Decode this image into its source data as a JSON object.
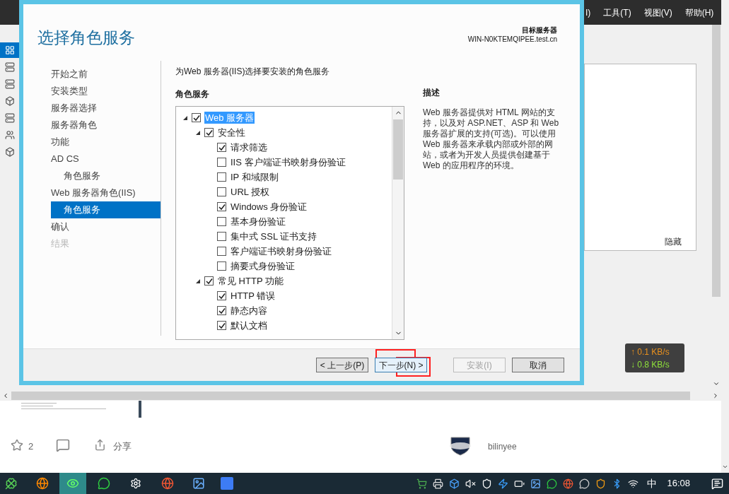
{
  "background_app": {
    "menu": [
      "I)",
      "工具(T)",
      "视图(V)",
      "帮助(H)"
    ],
    "hide_link": "隐藏"
  },
  "dialog": {
    "title": "选择角色服务",
    "target_label": "目标服务器",
    "target_server": "WIN-N0KTEMQIPEE.test.cn",
    "steps": [
      {
        "label": "开始之前",
        "selected": false,
        "disabled": false
      },
      {
        "label": "安装类型",
        "selected": false,
        "disabled": false
      },
      {
        "label": "服务器选择",
        "selected": false,
        "disabled": false
      },
      {
        "label": "服务器角色",
        "selected": false,
        "disabled": false
      },
      {
        "label": "功能",
        "selected": false,
        "disabled": false
      },
      {
        "label": "AD CS",
        "selected": false,
        "disabled": false,
        "children": [
          {
            "label": "角色服务",
            "selected": false,
            "disabled": false
          }
        ]
      },
      {
        "label": "Web 服务器角色(IIS)",
        "selected": false,
        "disabled": false,
        "children": [
          {
            "label": "角色服务",
            "selected": true,
            "disabled": false
          }
        ]
      },
      {
        "label": "确认",
        "selected": false,
        "disabled": false
      },
      {
        "label": "结果",
        "selected": false,
        "disabled": true
      }
    ],
    "intro": "为Web 服务器(IIS)选择要安装的角色服务",
    "tree_heading": "角色服务",
    "tree": [
      {
        "label": "Web 服务器",
        "checked": true,
        "expanded": true,
        "selected": true,
        "children": [
          {
            "label": "安全性",
            "checked": true,
            "expanded": true,
            "selected": false,
            "children": [
              {
                "label": "请求筛选",
                "checked": true,
                "selected": false
              },
              {
                "label": "IIS 客户端证书映射身份验证",
                "checked": false,
                "selected": false
              },
              {
                "label": "IP 和域限制",
                "checked": false,
                "selected": false
              },
              {
                "label": "URL 授权",
                "checked": false,
                "selected": false
              },
              {
                "label": "Windows 身份验证",
                "checked": true,
                "selected": false
              },
              {
                "label": "基本身份验证",
                "checked": false,
                "selected": false
              },
              {
                "label": "集中式 SSL 证书支持",
                "checked": false,
                "selected": false
              },
              {
                "label": "客户端证书映射身份验证",
                "checked": false,
                "selected": false
              },
              {
                "label": "摘要式身份验证",
                "checked": false,
                "selected": false
              }
            ]
          },
          {
            "label": "常见 HTTP 功能",
            "checked": true,
            "expanded": true,
            "selected": false,
            "children": [
              {
                "label": "HTTP 错误",
                "checked": true,
                "selected": false
              },
              {
                "label": "静态内容",
                "checked": true,
                "selected": false
              },
              {
                "label": "默认文档",
                "checked": true,
                "selected": false
              }
            ]
          }
        ]
      }
    ],
    "description_heading": "描述",
    "description": "Web 服务器提供对 HTML 网站的支持，以及对 ASP.NET、ASP 和 Web 服务器扩展的支持(可选)。可以使用 Web 服务器来承载内部或外部的网站，或者为开发人员提供创建基于 Web 的应用程序的环境。",
    "buttons": [
      {
        "label": "< 上一步(P)",
        "disabled": false,
        "focused": false
      },
      {
        "label": "下一步(N) >",
        "disabled": false,
        "focused": true
      },
      {
        "label": "安装(I)",
        "disabled": true,
        "focused": false
      },
      {
        "label": "取消",
        "disabled": false,
        "focused": false
      }
    ]
  },
  "network_monitor": {
    "upload": "↑ 0.1 KB/s",
    "download": "↓ 0.8 KB/s"
  },
  "article": {
    "likes": "2",
    "share": "分享",
    "author": "bilinyee"
  },
  "taskbar": {
    "ime": "中",
    "time": "16:08"
  }
}
